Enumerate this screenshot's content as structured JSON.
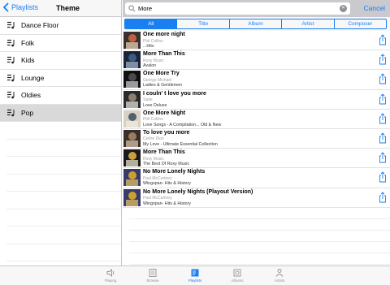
{
  "left": {
    "back_label": "Playlists",
    "title": "Theme",
    "items": [
      {
        "label": "Dance Floor",
        "selected": false
      },
      {
        "label": "Folk",
        "selected": false
      },
      {
        "label": "Kids",
        "selected": false
      },
      {
        "label": "Lounge",
        "selected": false
      },
      {
        "label": "Oldies",
        "selected": false
      },
      {
        "label": "Pop",
        "selected": true
      }
    ]
  },
  "search": {
    "value": "More",
    "cancel_label": "Cancel"
  },
  "segments": [
    "All",
    "Title",
    "Album",
    "Artist",
    "Composer"
  ],
  "active_segment": "All",
  "songs": [
    {
      "title": "One more night",
      "artist": "Phil Collins",
      "album": "...Hits",
      "thumb": [
        "#3a3030",
        "#c06040",
        "#e8d0b0"
      ]
    },
    {
      "title": "More Than This",
      "artist": "Roxy Music",
      "album": "Avalon",
      "thumb": [
        "#1a2438",
        "#3d5a80",
        "#9fb2c8"
      ]
    },
    {
      "title": "One More Try",
      "artist": "George Michael",
      "album": "Ladies & Gentlemen",
      "thumb": [
        "#101010",
        "#4a4a4a",
        "#c8c8c8"
      ]
    },
    {
      "title": "I couln' t love you more",
      "artist": "Sade",
      "album": "Love Deluxe",
      "thumb": [
        "#2a2a2a",
        "#8a8070",
        "#e0ddd5"
      ]
    },
    {
      "title": "One More Night",
      "artist": "Phil Collins",
      "album": "Love Songs - A Compilation... Old & New",
      "thumb": [
        "#d8d0c0",
        "#506070",
        "#f0ece4"
      ]
    },
    {
      "title": "To love you more",
      "artist": "Celine Dion",
      "album": "My Love - Ultimate Essential Collection",
      "thumb": [
        "#3a2e28",
        "#9a7a60",
        "#d8c0a8"
      ]
    },
    {
      "title": "More Than This",
      "artist": "Roxy Music",
      "album": "The Best Of Roxy Music",
      "thumb": [
        "#1a1a1a",
        "#c8a040",
        "#e8e0c8"
      ]
    },
    {
      "title": "No More Lonely Nights",
      "artist": "Paul McCartney",
      "album": "Wingspan- Hits & History",
      "thumb": [
        "#3a3a6a",
        "#c8a030",
        "#e0c060"
      ]
    },
    {
      "title": "No More Lonely Nights (Playout Version)",
      "artist": "Paul McCartney",
      "album": "Wingspan- Hits & History",
      "thumb": [
        "#3a3a6a",
        "#c8a030",
        "#e0c060"
      ]
    }
  ],
  "tabs": [
    {
      "label": "Playing",
      "icon": "speaker-icon",
      "active": false
    },
    {
      "label": "Browse",
      "icon": "browse-icon",
      "active": false
    },
    {
      "label": "Playlists",
      "icon": "playlists-icon",
      "active": true
    },
    {
      "label": "Albums",
      "icon": "albums-icon",
      "active": false
    },
    {
      "label": "Artists",
      "icon": "artists-icon",
      "active": false
    }
  ],
  "colors": {
    "accent": "#1a7ff0",
    "selected_row": "#d9d9d9",
    "search_bar": "#c9c9ce"
  }
}
